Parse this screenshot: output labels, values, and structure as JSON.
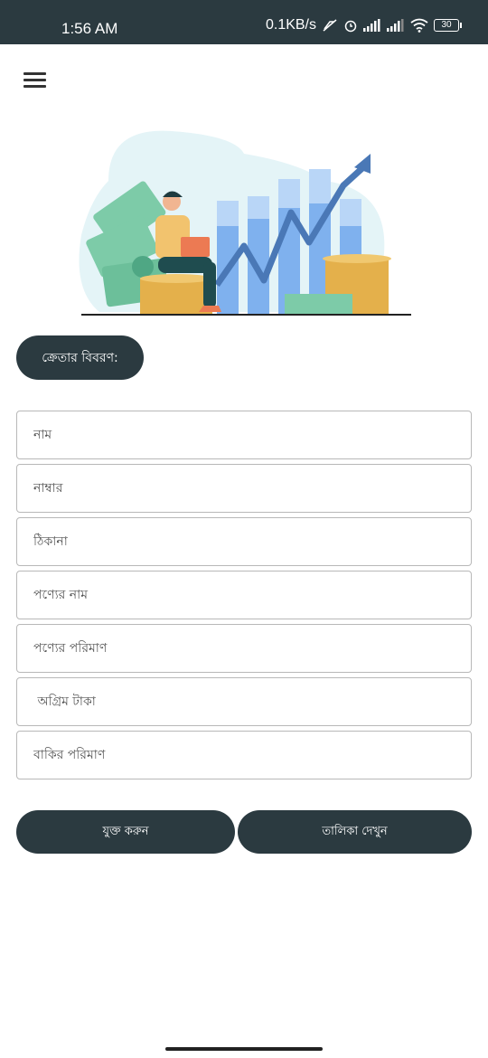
{
  "status_bar": {
    "time": "1:56 AM",
    "net_speed": "0.1KB/s",
    "battery": "30"
  },
  "header": {
    "menu_icon": "hamburger-menu-icon"
  },
  "hero": {
    "image": "investor-with-laptop-on-coins-rising-chart-illustration"
  },
  "section": {
    "title": "ক্রেতার বিবরণ:"
  },
  "form": {
    "fields": [
      {
        "placeholder": "নাম"
      },
      {
        "placeholder": "নাম্বার"
      },
      {
        "placeholder": "ঠিকানা"
      },
      {
        "placeholder": "পণ্যের নাম"
      },
      {
        "placeholder": "পণ্যের পরিমাণ"
      },
      {
        "placeholder": " অগ্রিম টাকা"
      },
      {
        "placeholder": "বাকির পরিমাণ"
      }
    ]
  },
  "actions": {
    "add_label": "যুক্ত করুন",
    "list_label": "তালিকা দেখুন"
  },
  "colors": {
    "primary": "#2b3a40",
    "field_border": "#b8b8b8"
  }
}
